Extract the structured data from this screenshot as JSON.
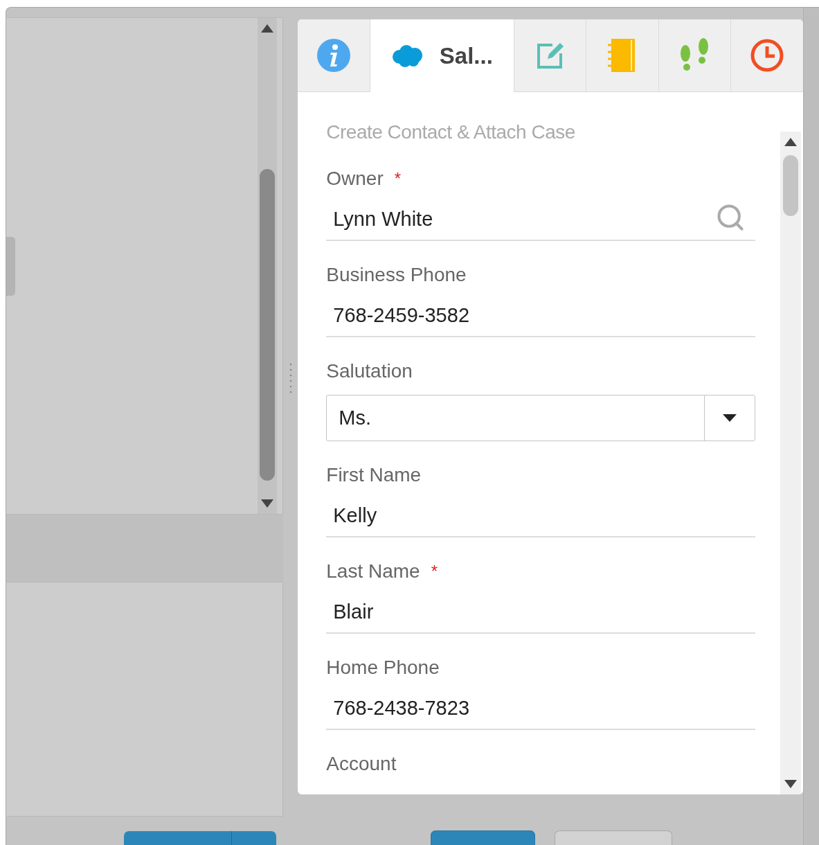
{
  "tabs": [
    {
      "kind": "info",
      "selected": false
    },
    {
      "kind": "cloud",
      "label": "Sal...",
      "selected": true
    },
    {
      "kind": "edit",
      "selected": false
    },
    {
      "kind": "notebook",
      "selected": false
    },
    {
      "kind": "footprints",
      "selected": false
    },
    {
      "kind": "clock",
      "selected": false
    }
  ],
  "form": {
    "title": "Create Contact & Attach Case",
    "fields": [
      {
        "kind": "lookup",
        "label": "Owner",
        "required_mark": "*",
        "value": "Lynn White"
      },
      {
        "kind": "text",
        "label": "Business Phone",
        "value": "768-2459-3582"
      },
      {
        "kind": "select",
        "label": "Salutation",
        "value": "Ms."
      },
      {
        "kind": "text",
        "label": "First Name",
        "value": "Kelly"
      },
      {
        "kind": "text",
        "label": "Last Name",
        "required_mark": "*",
        "value": "Blair"
      },
      {
        "kind": "text",
        "label": "Home Phone",
        "value": "768-2438-7823"
      },
      {
        "kind": "label",
        "label": "Account"
      }
    ]
  }
}
